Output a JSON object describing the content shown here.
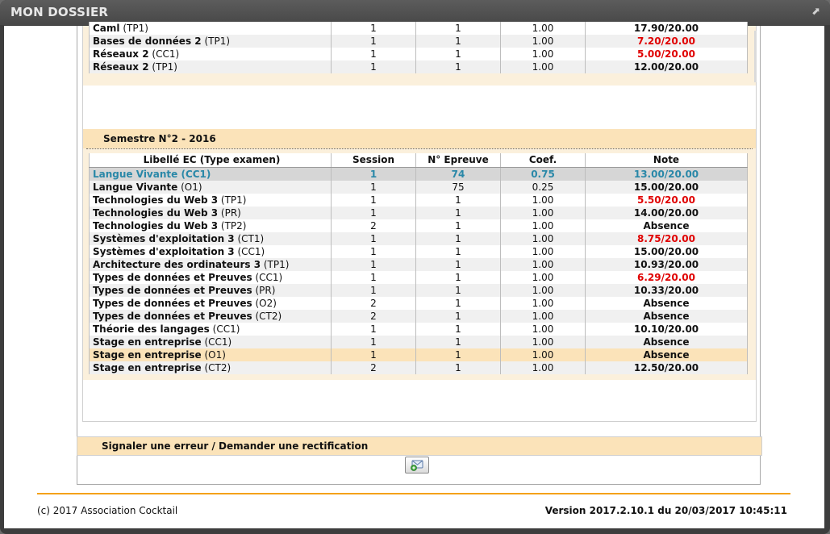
{
  "window": {
    "title": "MON DOSSIER"
  },
  "semester1": {
    "rows": [
      {
        "ec": "Caml",
        "type": "(TP1)",
        "session": "1",
        "epreuve": "1",
        "coef": "1.00",
        "note": "17.90/20.00",
        "failed": false
      },
      {
        "ec": "Bases de données 2",
        "type": "(TP1)",
        "session": "1",
        "epreuve": "1",
        "coef": "1.00",
        "note": "7.20/20.00",
        "failed": true
      },
      {
        "ec": "Réseaux 2",
        "type": "(CC1)",
        "session": "1",
        "epreuve": "1",
        "coef": "1.00",
        "note": "5.00/20.00",
        "failed": true
      },
      {
        "ec": "Réseaux 2",
        "type": "(TP1)",
        "session": "1",
        "epreuve": "1",
        "coef": "1.00",
        "note": "12.00/20.00",
        "failed": false
      }
    ]
  },
  "semester2": {
    "title": "Semestre N°2 - 2016",
    "headers": {
      "ec": "Libellé EC (Type examen)",
      "session": "Session",
      "epreuve": "N° Epreuve",
      "coef": "Coef.",
      "note": "Note"
    },
    "rows": [
      {
        "ec": "Langue Vivante",
        "type": "(CC1)",
        "session": "1",
        "epreuve": "74",
        "coef": "0.75",
        "note": "13.00/20.00",
        "failed": false
      },
      {
        "ec": "Langue Vivante",
        "type": "(O1)",
        "session": "1",
        "epreuve": "75",
        "coef": "0.25",
        "note": "15.00/20.00",
        "failed": false
      },
      {
        "ec": "Technologies du Web 3",
        "type": "(TP1)",
        "session": "1",
        "epreuve": "1",
        "coef": "1.00",
        "note": "5.50/20.00",
        "failed": true
      },
      {
        "ec": "Technologies du Web 3",
        "type": "(PR)",
        "session": "1",
        "epreuve": "1",
        "coef": "1.00",
        "note": "14.00/20.00",
        "failed": false
      },
      {
        "ec": "Technologies du Web 3",
        "type": "(TP2)",
        "session": "2",
        "epreuve": "1",
        "coef": "1.00",
        "note": "Absence",
        "failed": false
      },
      {
        "ec": "Systèmes d'exploitation 3",
        "type": "(CT1)",
        "session": "1",
        "epreuve": "1",
        "coef": "1.00",
        "note": "8.75/20.00",
        "failed": true
      },
      {
        "ec": "Systèmes d'exploitation 3",
        "type": "(CC1)",
        "session": "1",
        "epreuve": "1",
        "coef": "1.00",
        "note": "15.00/20.00",
        "failed": false
      },
      {
        "ec": "Architecture des ordinateurs 3",
        "type": "(TP1)",
        "session": "1",
        "epreuve": "1",
        "coef": "1.00",
        "note": "10.93/20.00",
        "failed": false
      },
      {
        "ec": "Types de données et Preuves",
        "type": "(CC1)",
        "session": "1",
        "epreuve": "1",
        "coef": "1.00",
        "note": "6.29/20.00",
        "failed": true
      },
      {
        "ec": "Types de données et Preuves",
        "type": "(PR)",
        "session": "1",
        "epreuve": "1",
        "coef": "1.00",
        "note": "10.33/20.00",
        "failed": false
      },
      {
        "ec": "Types de données et Preuves",
        "type": "(O2)",
        "session": "2",
        "epreuve": "1",
        "coef": "1.00",
        "note": "Absence",
        "failed": false
      },
      {
        "ec": "Types de données et Preuves",
        "type": "(CT2)",
        "session": "2",
        "epreuve": "1",
        "coef": "1.00",
        "note": "Absence",
        "failed": false
      },
      {
        "ec": "Théorie des langages",
        "type": "(CC1)",
        "session": "1",
        "epreuve": "1",
        "coef": "1.00",
        "note": "10.10/20.00",
        "failed": false
      },
      {
        "ec": "Stage en entreprise",
        "type": "(CC1)",
        "session": "1",
        "epreuve": "1",
        "coef": "1.00",
        "note": "Absence",
        "failed": false
      },
      {
        "ec": "Stage en entreprise",
        "type": "(O1)",
        "session": "1",
        "epreuve": "1",
        "coef": "1.00",
        "note": "Absence",
        "failed": false
      },
      {
        "ec": "Stage en entreprise",
        "type": "(CT2)",
        "session": "2",
        "epreuve": "1",
        "coef": "1.00",
        "note": "12.50/20.00",
        "failed": false
      }
    ]
  },
  "signal": {
    "label": "Signaler une erreur / Demander une rectification",
    "button_icon": "send-mail-icon"
  },
  "footer": {
    "copyright": "(c) 2017 Association Cocktail",
    "version": "Version 2017.2.10.1 du 20/03/2017 10:45:11"
  },
  "colors": {
    "accent": "#f4a21a",
    "header_bg": "#fbe3b9",
    "failed": "#e00000",
    "selected_text": "#2a88a8"
  }
}
